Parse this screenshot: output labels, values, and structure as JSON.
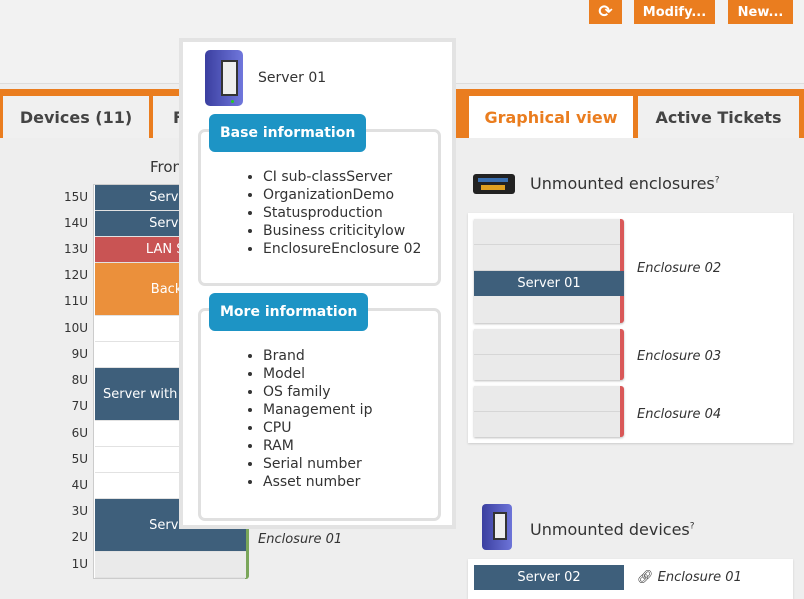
{
  "toolbar": {
    "refresh_icon": "refresh-icon",
    "modify_label": "Modify...",
    "new_label": "New..."
  },
  "tabs": [
    {
      "label": "Devices (11)"
    },
    {
      "label": "F"
    },
    {
      "label": "Graphical view",
      "active": true
    },
    {
      "label": "Active Tickets"
    }
  ],
  "rack": {
    "title": "Fron",
    "units": [
      "15U",
      "14U",
      "13U",
      "12U",
      "11U",
      "10U",
      "9U",
      "8U",
      "7U",
      "6U",
      "5U",
      "4U",
      "3U",
      "2U",
      "1U"
    ],
    "devices": [
      {
        "label": "Server",
        "color": "#3e5f7b"
      },
      {
        "label": "Server",
        "color": "#3e5f7b"
      },
      {
        "label": "LAN Sw",
        "color": "#c95454"
      },
      {
        "label": "Backu",
        "color": "#eb903b"
      },
      {
        "label": "Server with",
        "color": "#3e5f7b"
      },
      {
        "label": "Server",
        "color": "#3e5f7b"
      }
    ],
    "enclosure_label": "Enclosure 01"
  },
  "popover": {
    "title": "Server 01",
    "icon": "server-icon",
    "base": {
      "legend": "Base information",
      "items": [
        "CI sub-classServer",
        "OrganizationDemo",
        "Statusproduction",
        "Business criticitylow",
        "EnclosureEnclosure 02"
      ]
    },
    "more": {
      "legend": "More information",
      "items": [
        "Brand",
        "Model",
        "OS family",
        "Management ip",
        "CPU",
        "RAM",
        "Serial number",
        "Asset number"
      ]
    }
  },
  "unmounted_enclosures": {
    "title": "Unmounted enclosures",
    "help": "?",
    "icon": "enclosure-icon",
    "items": [
      {
        "name": "Enclosure 02",
        "device": "Server 01"
      },
      {
        "name": "Enclosure 03"
      },
      {
        "name": "Enclosure 04"
      }
    ]
  },
  "unmounted_devices": {
    "title": "Unmounted devices",
    "help": "?",
    "icon": "server-icon",
    "items": [
      {
        "name": "Server 02",
        "enclosure": "Enclosure 01",
        "link_icon": "link-icon"
      }
    ]
  },
  "colors": {
    "accent": "#ea7d1f",
    "device": "#3e5f7b",
    "legend": "#1d94c5",
    "enclosure_bar": "#d95858",
    "rack_bar": "#7aa65a"
  }
}
